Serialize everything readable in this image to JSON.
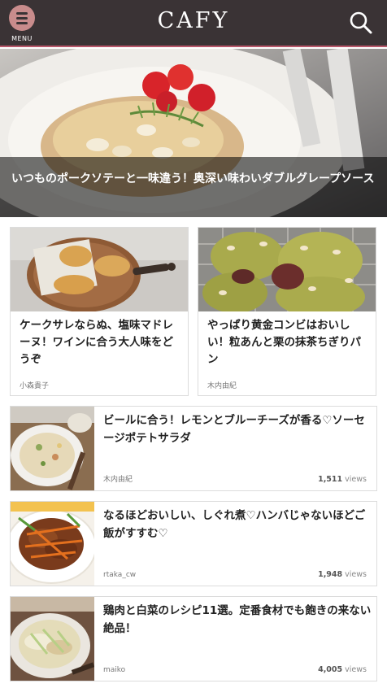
{
  "header": {
    "logo": "CAFY",
    "menu_label": "MENU"
  },
  "hero": {
    "title": "いつものポークソテーと一味違う！奥深い味わいダブルグレープソース"
  },
  "cards": [
    {
      "title": "ケークサレならぬ、塩味マドレーヌ！ワインに合う大人味をどうぞ",
      "author": "小森貴子"
    },
    {
      "title": "やっぱり黄金コンビはおいしい！粒あんと栗の抹茶ちぎりパン",
      "author": "木内由紀"
    }
  ],
  "list": [
    {
      "title": "ビールに合う！レモンとブルーチーズが香る♡ソーセージポテトサラダ",
      "author": "木内由紀",
      "views": "1,511",
      "views_unit": "views"
    },
    {
      "title": "なるほどおいしい、しぐれ煮♡ハンバじゃないほどご飯がすすむ♡",
      "author": "rtaka_cw",
      "views": "1,948",
      "views_unit": "views"
    },
    {
      "title": "鶏肉と白菜のレシピ11選。定番食材でも飽きの来ない絶品！",
      "author": "maiko",
      "views": "4,005",
      "views_unit": "views"
    }
  ],
  "colors": {
    "header_bg": "#3a3335",
    "accent": "#c98c8c",
    "header_border": "#b8576a"
  }
}
